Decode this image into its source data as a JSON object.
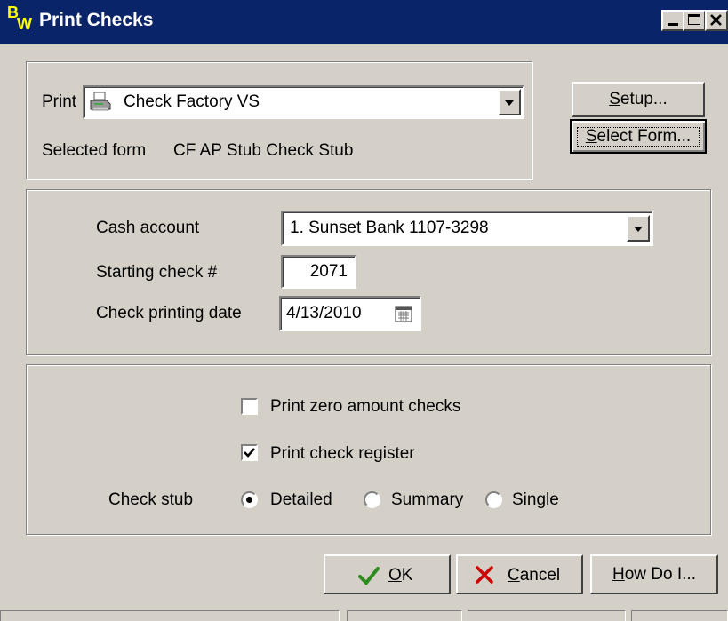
{
  "window": {
    "logo_b": "B",
    "logo_w": "W",
    "title": "Print Checks"
  },
  "printer": {
    "label": "Print",
    "selected": "Check Factory VS",
    "form_label": "Selected form",
    "form_value": "CF AP Stub Check Stub"
  },
  "buttons": {
    "setup": "Setup...",
    "select_form": "Select Form...",
    "ok": "OK",
    "cancel": "Cancel",
    "how_do_i": "How Do I..."
  },
  "account": {
    "cash_label": "Cash account",
    "cash_value": "1. Sunset Bank 1107-3298",
    "check_num_label": "Starting check #",
    "check_num_value": "2071",
    "date_label": "Check printing date",
    "date_value": "4/13/2010"
  },
  "options": {
    "zero_label": "Print zero amount checks",
    "zero_checked": false,
    "register_label": "Print check register",
    "register_checked": true,
    "stub_label": "Check stub",
    "stub_options": [
      "Detailed",
      "Summary",
      "Single"
    ],
    "stub_selected": "Detailed"
  },
  "colors": {
    "titlebar": "#0a246a",
    "face": "#d4d0c8",
    "ok_check": "#2e8b1e",
    "cancel_x": "#cc0000"
  }
}
